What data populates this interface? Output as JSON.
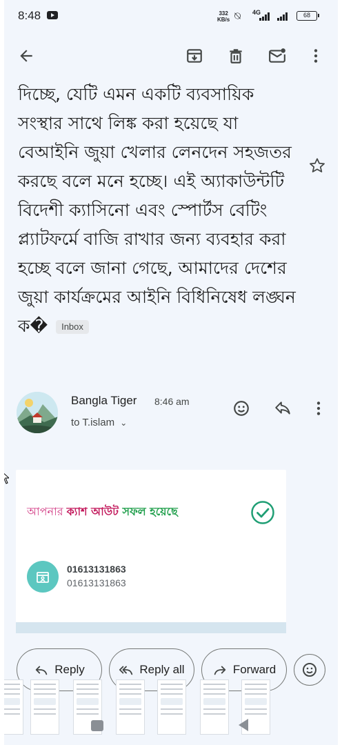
{
  "status_bar": {
    "time": "8:48",
    "speed_value": "332",
    "speed_unit": "KB/s",
    "network": "4G",
    "battery": "68"
  },
  "app_bar": {
    "back_icon": "arrow-back-icon",
    "archive_icon": "archive-icon",
    "delete_icon": "trash-icon",
    "mark_unread_icon": "mail-unread-icon",
    "more_icon": "more-vert-icon"
  },
  "email": {
    "body_text": "দিচ্ছে, যেটি এমন একটি ব্যবসায়িক সংস্থার সাথে লিঙ্ক করা হয়েছে যা বেআইনি জুয়া খেলার লেনদেন সহজতর করছে বলে মনে হচ্ছে। এই অ্যাকাউন্টটি বিদেশী ক্যাসিনো এবং স্পোর্টস বেটিং প্ল্যাটফর্মে বাজি রাখার জন্য ব্যবহার করা হচ্ছে বলে জানা গেছে, আমাদের দেশের জুয়া কার্যক্রমের আইনি বিধিনিষেধ লঙ্ঘন ক�",
    "label_chip": "Inbox",
    "sender_name": "Bangla Tiger",
    "sent_time": "8:46 am",
    "recipient": "to T.islam"
  },
  "card": {
    "message_part1": "আপনার ",
    "message_part2": "ক্যাশ আউট ",
    "message_part3": " সফল হয়েছে",
    "account_number": "01613131863",
    "account_number_secondary": "01613131863"
  },
  "actions": {
    "reply": "Reply",
    "reply_all": "Reply all",
    "forward": "Forward"
  },
  "colors": {
    "accent_pink": "#c2185b",
    "accent_green": "#1e9e4a",
    "check_teal": "#1f9e74"
  }
}
